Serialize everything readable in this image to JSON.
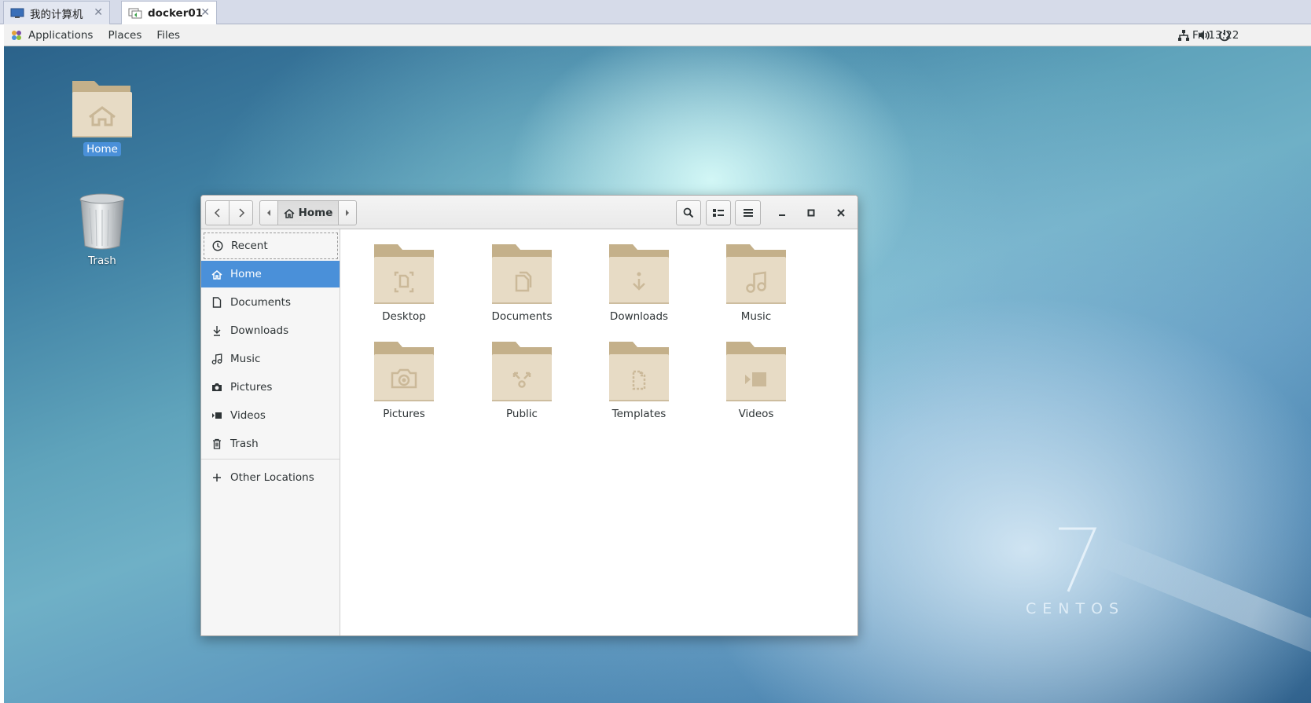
{
  "vm_tabs": [
    {
      "label": "我的计算机",
      "active": false
    },
    {
      "label": "docker01",
      "active": true
    }
  ],
  "topbar": {
    "menus": [
      "Applications",
      "Places",
      "Files"
    ],
    "clock": "Fri 13:22"
  },
  "desktop": {
    "icons": [
      {
        "label": "Home"
      },
      {
        "label": "Trash"
      }
    ],
    "branding": {
      "number": "7",
      "word": "CENTOS"
    }
  },
  "window": {
    "path_label": "Home",
    "sidebar": [
      {
        "label": "Recent",
        "icon": "clock-icon"
      },
      {
        "label": "Home",
        "icon": "home-icon"
      },
      {
        "label": "Documents",
        "icon": "document-icon"
      },
      {
        "label": "Downloads",
        "icon": "download-icon"
      },
      {
        "label": "Music",
        "icon": "music-icon"
      },
      {
        "label": "Pictures",
        "icon": "camera-icon"
      },
      {
        "label": "Videos",
        "icon": "video-icon"
      },
      {
        "label": "Trash",
        "icon": "trash-icon"
      },
      {
        "label": "Other Locations",
        "icon": "plus-icon"
      }
    ],
    "folders": [
      {
        "name": "Desktop",
        "icon": "desktop-folder-icon"
      },
      {
        "name": "Documents",
        "icon": "documents-folder-icon"
      },
      {
        "name": "Downloads",
        "icon": "downloads-folder-icon"
      },
      {
        "name": "Music",
        "icon": "music-folder-icon"
      },
      {
        "name": "Pictures",
        "icon": "pictures-folder-icon"
      },
      {
        "name": "Public",
        "icon": "public-folder-icon"
      },
      {
        "name": "Templates",
        "icon": "templates-folder-icon"
      },
      {
        "name": "Videos",
        "icon": "videos-folder-icon"
      }
    ]
  },
  "colors": {
    "selection": "#4a90d9",
    "folder_body": "#e7dbc5",
    "folder_tab": "#c4b08a"
  }
}
